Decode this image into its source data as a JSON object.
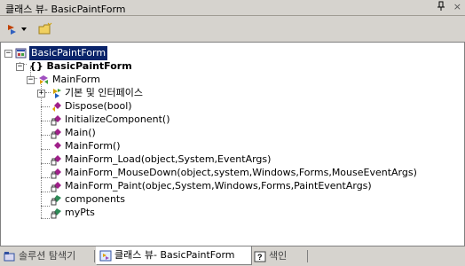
{
  "window": {
    "title": "클래스 뷰- BasicPaintForm",
    "pin_glyph": "ᵖ",
    "close_glyph": "×"
  },
  "toolbar": {
    "sort_icon": "sort-by-icon",
    "new_folder_icon": "new-folder-icon"
  },
  "tree": {
    "nodes": [
      {
        "label": "BasicPaintForm",
        "icon": "project-icon",
        "expander": "−",
        "selected": true
      },
      {
        "label": "{} BasicPaintForm",
        "icon": "namespace-icon",
        "expander": "−"
      },
      {
        "label": "MainForm",
        "icon": "class-icon",
        "expander": "−"
      },
      {
        "label": "기본 및 인터페이스",
        "icon": "bases-interfaces-icon",
        "expander": "+"
      },
      {
        "label": "Dispose(bool)",
        "icon": "protected-method-icon"
      },
      {
        "label": "InitializeComponent()",
        "icon": "private-method-icon"
      },
      {
        "label": "Main()",
        "icon": "private-method-icon"
      },
      {
        "label": "MainForm()",
        "icon": "public-method-icon"
      },
      {
        "label": "MainForm_Load(object,System,EventArgs)",
        "icon": "private-method-icon"
      },
      {
        "label": "MainForm_MouseDown(object,system,Windows,Forms,MouseEventArgs)",
        "icon": "private-method-icon"
      },
      {
        "label": "MainForm_Paint(objec,System,Windows,Forms,PaintEventArgs)",
        "icon": "private-method-icon"
      },
      {
        "label": "components",
        "icon": "private-field-icon"
      },
      {
        "label": "myPts",
        "icon": "private-field-icon"
      }
    ]
  },
  "tabs": [
    {
      "label": "솔루션 탐색기",
      "icon": "solution-explorer-icon",
      "active": false
    },
    {
      "label": "클래스 뷰- BasicPaintForm",
      "icon": "class-view-icon",
      "active": true
    },
    {
      "label": "색인",
      "icon": "help-index-icon",
      "active": false
    }
  ],
  "colors": {
    "chrome": "#d6d3ce",
    "selection": "#0a246a",
    "method": "#8b1a8b",
    "field": "#2e8b57"
  }
}
